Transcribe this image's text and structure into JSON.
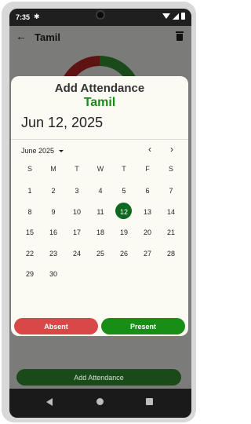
{
  "status_bar": {
    "time": "7:35"
  },
  "app_bar": {
    "title": "Tamil"
  },
  "dialog": {
    "title": "Add Attendance",
    "subtitle": "Tamil",
    "selected_date": "Jun 12, 2025",
    "month_label": "June 2025",
    "weekdays": [
      "S",
      "M",
      "T",
      "W",
      "T",
      "F",
      "S"
    ],
    "days": [
      "",
      "",
      "",
      "",
      "",
      "",
      "",
      "1",
      "2",
      "3",
      "4",
      "5",
      "6",
      "7",
      "8",
      "9",
      "10",
      "11",
      "12",
      "13",
      "14",
      "15",
      "16",
      "17",
      "18",
      "19",
      "20",
      "21",
      "22",
      "23",
      "24",
      "25",
      "26",
      "27",
      "28",
      "29",
      "30"
    ],
    "selected_day": "12",
    "absent_label": "Absent",
    "present_label": "Present"
  },
  "bottom_button": {
    "label": "Add Attendance"
  },
  "colors": {
    "present": "#178f17",
    "absent": "#d94848",
    "selected_day": "#0b6a1f"
  }
}
